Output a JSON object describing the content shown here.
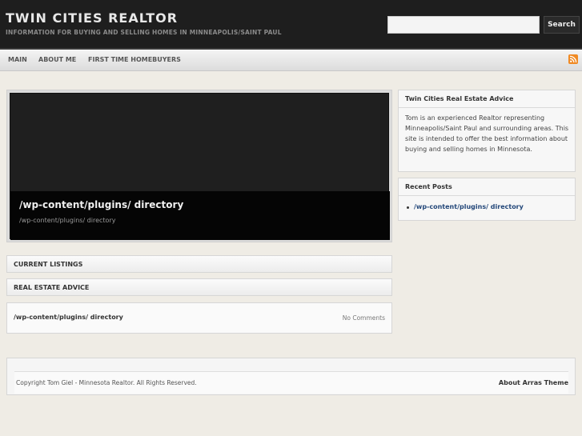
{
  "header": {
    "site_title": "TWIN CITIES REALTOR",
    "tagline": "INFORMATION FOR BUYING AND SELLING HOMES IN MINNEAPOLIS/SAINT PAUL",
    "search_placeholder": "",
    "search_button": "Search"
  },
  "nav": {
    "items": [
      {
        "label": "MAIN"
      },
      {
        "label": "ABOUT ME"
      },
      {
        "label": "FIRST TIME HOMEBUYERS"
      }
    ],
    "rss_icon": "rss-icon"
  },
  "featured": {
    "title": "/wp-content/plugins/ directory",
    "subtitle": "/wp-content/plugins/ directory"
  },
  "sections": {
    "current_listings": "CURRENT LISTINGS",
    "real_estate_advice": "REAL ESTATE ADVICE"
  },
  "post": {
    "title": "/wp-content/plugins/ directory",
    "comments": "No Comments"
  },
  "sidebar": {
    "about": {
      "title": "Twin Cities Real Estate Advice",
      "text": "Tom is an experienced Realtor representing Minneapolis/Saint Paul and surrounding areas. This site is intended to offer the best information about buying and selling homes in Minnesota."
    },
    "recent": {
      "title": "Recent Posts",
      "items": [
        {
          "label": "/wp-content/plugins/ directory"
        }
      ]
    }
  },
  "footer": {
    "copyright": "Copyright Tom Giel - Minnesota Realtor. All Rights Reserved.",
    "theme_link": "About Arras Theme"
  },
  "colors": {
    "header_bg": "#1e1e1e",
    "page_bg": "#efece5",
    "rss_orange": "#f08a24",
    "link_blue": "#24487a"
  }
}
